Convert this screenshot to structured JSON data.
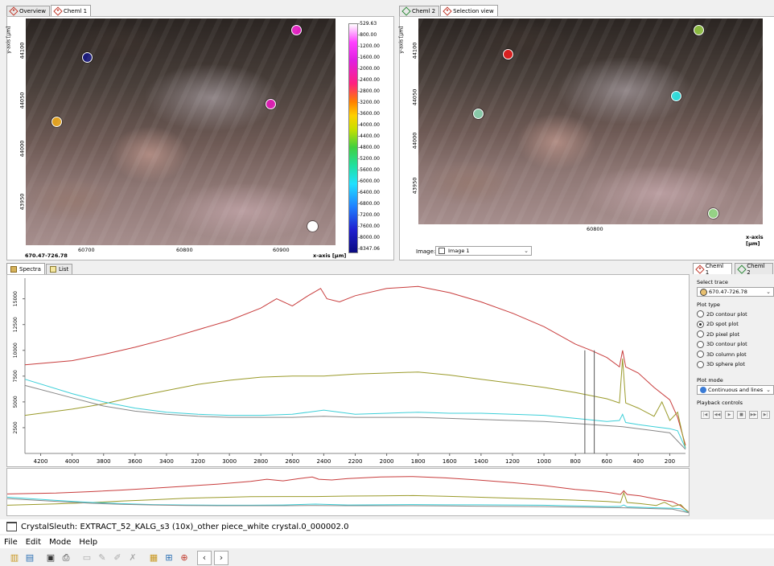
{
  "tabs_left": [
    {
      "label": "Overview",
      "active": false
    },
    {
      "label": "Cheml 1",
      "active": true
    }
  ],
  "tabs_right": [
    {
      "label": "Cheml 2",
      "active": false
    },
    {
      "label": "Selection view",
      "active": true
    }
  ],
  "left_view": {
    "y_axis_label": "y-axis [µm]",
    "y_ticks": [
      "44100",
      "44050",
      "44000",
      "43950"
    ],
    "x_ticks": [
      "60700",
      "60800",
      "60900"
    ],
    "x_axis_label": "x-axis [µm]",
    "coord": "670.47-726.78",
    "spots": [
      {
        "color": "#1c1c7a"
      },
      {
        "color": "#e0a020"
      },
      {
        "color": "#e020c0"
      },
      {
        "color": "#d820b0"
      },
      {
        "color": "#ffffff"
      }
    ]
  },
  "colorbar": {
    "labels": [
      "-529.63",
      "-800.00",
      "-1200.00",
      "-1600.00",
      "-2000.00",
      "-2400.00",
      "-2800.00",
      "-3200.00",
      "-3600.00",
      "-4000.00",
      "-4400.00",
      "-4800.00",
      "-5200.00",
      "-5600.00",
      "-6000.00",
      "-6400.00",
      "-6800.00",
      "-7200.00",
      "-7600.00",
      "-8000.00",
      "-8347.06"
    ]
  },
  "right_view": {
    "y_axis_label": "y-axis [µm]",
    "y_ticks": [
      "44100",
      "44050",
      "44000",
      "43950"
    ],
    "x_ticks": [
      "60800"
    ],
    "x_axis_label": "x-axis [µm]",
    "image_label": "Image:",
    "image_value": "Image 1",
    "spots": [
      {
        "color": "#d82020"
      },
      {
        "color": "#8ab840"
      },
      {
        "color": "#88c8a8"
      },
      {
        "color": "#30d8d8"
      },
      {
        "color": "#90d080"
      }
    ]
  },
  "spectra_tabs": [
    {
      "label": "Spectra",
      "active": true
    },
    {
      "label": "List",
      "active": false
    }
  ],
  "chart_data": {
    "type": "line",
    "x_ticks": [
      "4200",
      "4000",
      "3800",
      "3600",
      "3400",
      "3200",
      "3000",
      "2800",
      "2600",
      "2400",
      "2200",
      "2000",
      "1800",
      "1600",
      "1400",
      "1200",
      "1000",
      "800",
      "600",
      "400",
      "200"
    ],
    "y_ticks": [
      "15000",
      "12500",
      "10000",
      "7500",
      "5000",
      "2500"
    ],
    "xlim": [
      4300,
      100
    ],
    "ylim": [
      0,
      17000
    ],
    "series": [
      {
        "color": "#c83c3c",
        "x": [
          4300,
          4000,
          3800,
          3600,
          3400,
          3200,
          3000,
          2800,
          2700,
          2600,
          2500,
          2420,
          2380,
          2300,
          2200,
          2000,
          1800,
          1600,
          1400,
          1200,
          1000,
          800,
          700,
          600,
          520,
          500,
          480,
          400,
          300,
          200,
          150,
          100
        ],
        "y": [
          8600,
          9000,
          9600,
          10300,
          11100,
          12000,
          12900,
          14100,
          15000,
          14300,
          15300,
          16000,
          15000,
          14700,
          15300,
          16000,
          16200,
          15600,
          14700,
          13600,
          12300,
          10600,
          10000,
          9300,
          8400,
          10000,
          8400,
          7800,
          6400,
          5200,
          3500,
          800
        ]
      },
      {
        "color": "#9a9a2a",
        "x": [
          4300,
          4000,
          3800,
          3600,
          3400,
          3200,
          3000,
          2800,
          2600,
          2400,
          2200,
          2000,
          1800,
          1600,
          1400,
          1200,
          1000,
          800,
          600,
          520,
          500,
          480,
          400,
          300,
          250,
          200,
          150,
          100
        ],
        "y": [
          3700,
          4300,
          4800,
          5500,
          6100,
          6700,
          7100,
          7400,
          7500,
          7500,
          7700,
          7800,
          7900,
          7600,
          7200,
          6800,
          6400,
          5900,
          5300,
          4900,
          9200,
          4900,
          4400,
          3600,
          5000,
          3200,
          4000,
          500
        ]
      },
      {
        "color": "#3ccfd8",
        "x": [
          4300,
          4000,
          3800,
          3600,
          3400,
          3200,
          3000,
          2800,
          2600,
          2400,
          2200,
          2000,
          1800,
          1600,
          1400,
          1200,
          1000,
          800,
          600,
          520,
          500,
          480,
          400,
          300,
          200,
          150,
          100
        ],
        "y": [
          7200,
          5800,
          5000,
          4400,
          4000,
          3800,
          3700,
          3700,
          3800,
          4200,
          3800,
          3900,
          4000,
          3900,
          3900,
          3800,
          3700,
          3400,
          3100,
          3200,
          3800,
          3000,
          2800,
          2600,
          2400,
          2200,
          500
        ]
      },
      {
        "color": "#888888",
        "x": [
          4300,
          4000,
          3800,
          3600,
          3400,
          3200,
          3000,
          2800,
          2600,
          2400,
          2200,
          2000,
          1800,
          1600,
          1400,
          1200,
          1000,
          800,
          600,
          500,
          400,
          300,
          200,
          100
        ],
        "y": [
          6600,
          5400,
          4600,
          4100,
          3800,
          3600,
          3500,
          3500,
          3500,
          3600,
          3500,
          3500,
          3500,
          3400,
          3300,
          3200,
          3100,
          2900,
          2700,
          2600,
          2400,
          2200,
          2000,
          400
        ]
      }
    ],
    "markers_x": [
      740,
      680
    ]
  },
  "right_panel": {
    "tabs": [
      {
        "label": "Cheml 1",
        "active": true
      },
      {
        "label": "Cheml 2",
        "active": false
      }
    ],
    "select_trace_label": "Select trace",
    "trace_value": "670.47-726.78",
    "plot_type_label": "Plot type",
    "plot_types": [
      {
        "label": "2D contour plot",
        "on": false
      },
      {
        "label": "2D spot plot",
        "on": true
      },
      {
        "label": "2D pixel plot",
        "on": false
      },
      {
        "label": "3D contour plot",
        "on": false
      },
      {
        "label": "3D column plot",
        "on": false
      },
      {
        "label": "3D sphere plot",
        "on": false
      }
    ],
    "plot_mode_label": "Plot mode",
    "plot_mode_value": "Continuous and lines",
    "playback_label": "Playback controls",
    "playback": [
      "|◀",
      "◀◀",
      "▶",
      "■",
      "▶▶",
      "▶|"
    ]
  },
  "titlebar": {
    "text": "CrystalSleuth: EXTRACT_52_KALG_s3 (10x)_other piece_white crystal.0_000002.0"
  },
  "menu": [
    "File",
    "Edit",
    "Mode",
    "Help"
  ]
}
